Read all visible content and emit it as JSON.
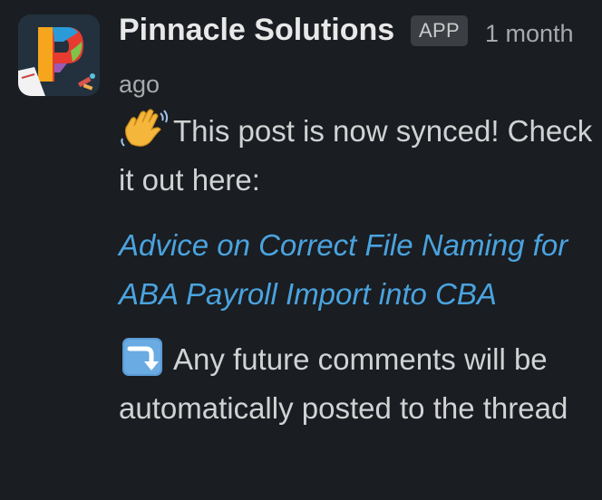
{
  "message": {
    "sender_name": "Pinnacle Solutions",
    "badge": "APP",
    "timestamp_line1": "1 month",
    "timestamp_line2": "ago",
    "avatar_icon": "pinnacle-logo-icon",
    "colors": {
      "background": "#1a1d21",
      "text": "#d1d2d3",
      "link": "#4aa3df",
      "badge_bg": "#3b3e42",
      "timestamp": "#a7a9ab"
    },
    "para1": {
      "emoji_icon": "waving-hand-icon",
      "text": "This post is now synced! Check it out here:"
    },
    "link_text": "Advice on Correct File Naming for ABA Payroll Import into CBA",
    "para3": {
      "emoji_icon": "arrow-curving-down-icon",
      "text": "Any future comments will be automatically posted to the thread"
    }
  }
}
